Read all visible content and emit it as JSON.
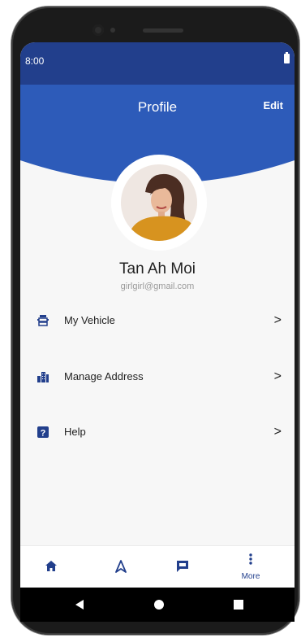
{
  "status_bar": {
    "time": "8:00"
  },
  "header": {
    "title": "Profile",
    "edit_label": "Edit"
  },
  "profile": {
    "name": "Tan Ah Moi",
    "email": "girlgirl@gmail.com"
  },
  "menu": [
    {
      "label": "My Vehicle",
      "icon": "vehicle-icon"
    },
    {
      "label": "Manage Address",
      "icon": "building-icon"
    },
    {
      "label": "Help",
      "icon": "help-icon"
    }
  ],
  "bottom_nav": {
    "items": [
      {
        "icon": "home-icon"
      },
      {
        "icon": "navigation-icon"
      },
      {
        "icon": "chat-icon"
      },
      {
        "icon": "more-icon",
        "label": "More"
      }
    ]
  },
  "system_nav": {
    "items": [
      "back-icon",
      "home-circle-icon",
      "recents-icon"
    ]
  },
  "colors": {
    "primary": "#223f8c",
    "header_blue": "#2d5bb9",
    "background": "#f7f7f7"
  }
}
